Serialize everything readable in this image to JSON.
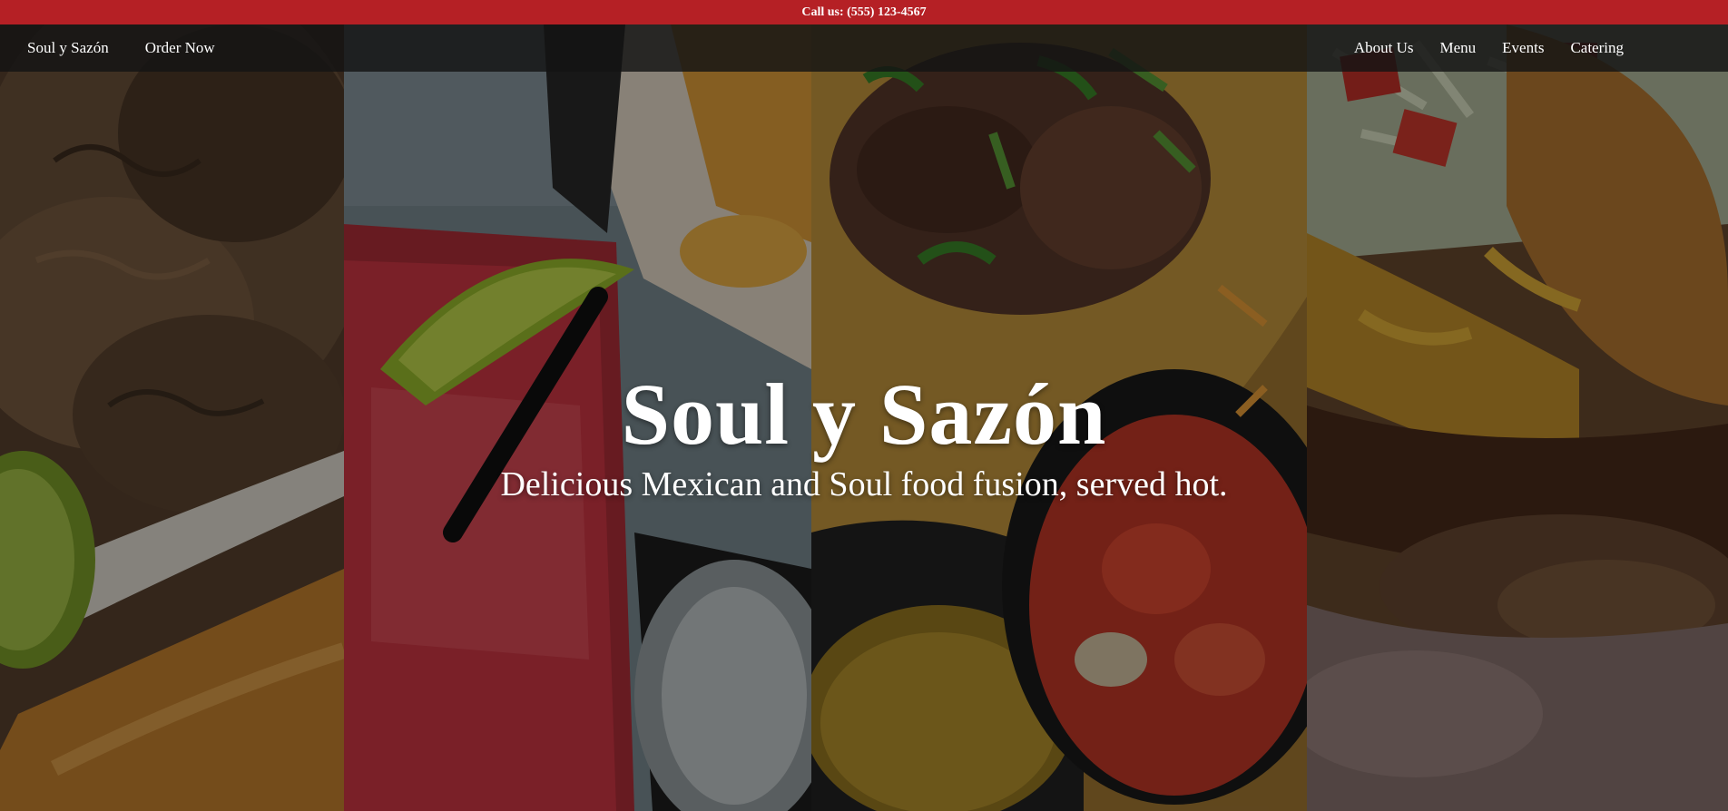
{
  "topbar": {
    "call_text": "Call us: (555) 123-4567"
  },
  "nav": {
    "brand": "Soul y Sazón",
    "order_now": "Order Now",
    "links": [
      "About Us",
      "Menu",
      "Events",
      "Catering"
    ]
  },
  "hero": {
    "title": "Soul y Sazón",
    "subtitle": "Delicious Mexican and Soul food fusion, served hot."
  },
  "colors": {
    "topbar_bg": "#b52025",
    "nav_bg": "rgba(20,20,20,0.82)",
    "text": "#ffffff"
  }
}
